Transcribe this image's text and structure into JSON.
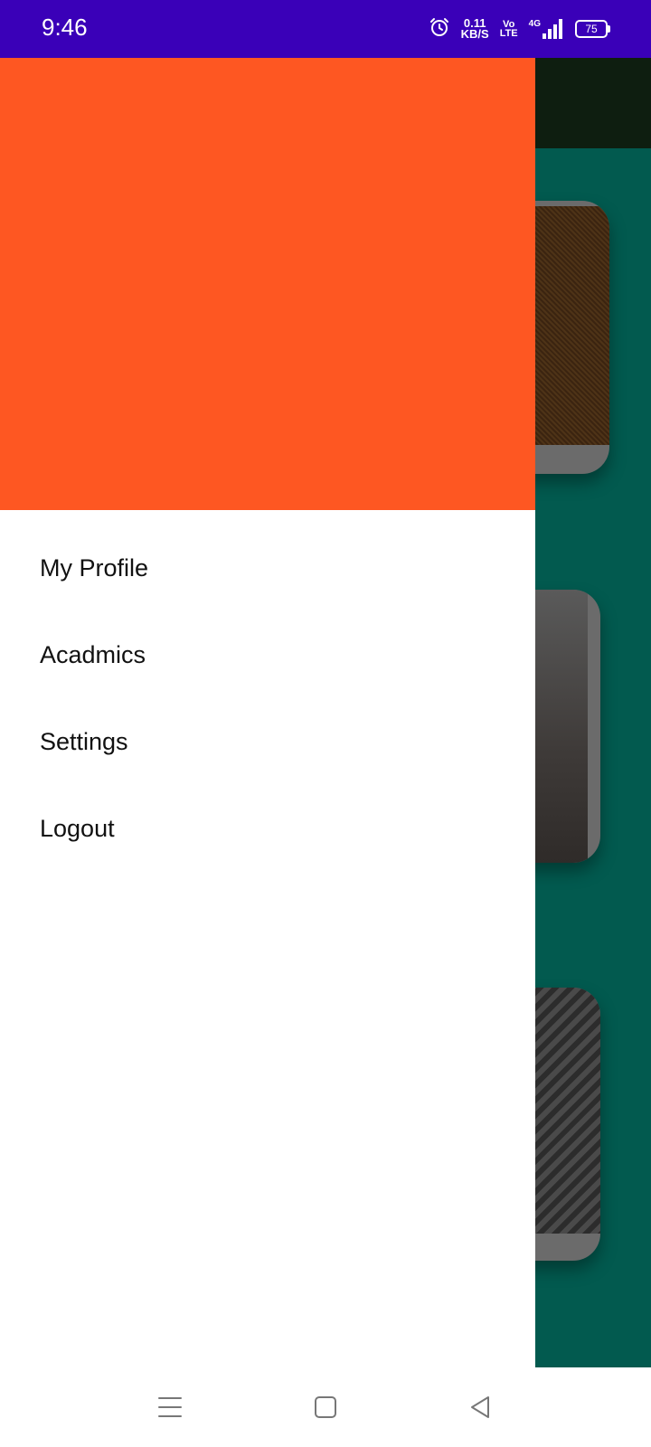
{
  "status_bar": {
    "time": "9:46",
    "net_speed_value": "0.11",
    "net_speed_unit": "KB/S",
    "volte_top": "Vo",
    "volte_bottom": "LTE",
    "network": "4G",
    "battery": "75",
    "icons": [
      "alarm-icon",
      "signal-icon",
      "battery-icon"
    ]
  },
  "drawer": {
    "header_color": "#fe5722",
    "menu": [
      {
        "label": "My Profile"
      },
      {
        "label": "Acadmics"
      },
      {
        "label": "Settings"
      },
      {
        "label": "Logout"
      }
    ]
  },
  "nav_bar": {
    "icons": [
      "recent-apps-icon",
      "home-icon",
      "back-icon"
    ]
  },
  "colors": {
    "status_bar": "#3a00b8",
    "app_background": "#025a4f",
    "app_toolbar": "#0e1e10"
  }
}
